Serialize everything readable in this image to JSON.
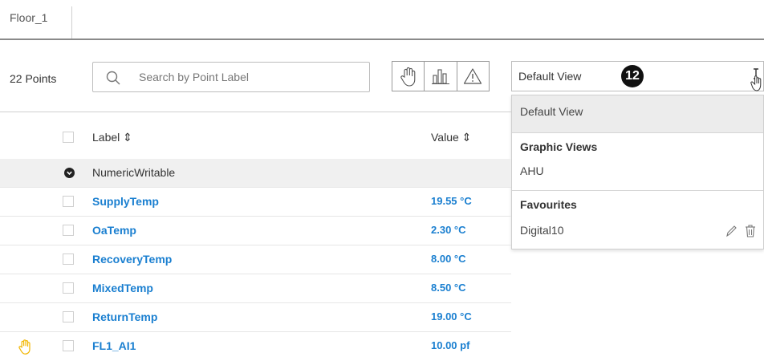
{
  "tabs": [
    {
      "label": "Floor_1"
    }
  ],
  "toolbar": {
    "points_count": "22 Points",
    "search_placeholder": "Search by Point Label",
    "view_selected": "Default View",
    "badge": "12"
  },
  "dropdown": {
    "default_option": "Default View",
    "graphic_views_heading": "Graphic Views",
    "graphic_views": [
      "AHU"
    ],
    "favourites_heading": "Favourites",
    "favourites": [
      "Digital10"
    ]
  },
  "table": {
    "columns": {
      "label": "Label ⇕",
      "value": "Value ⇕"
    },
    "group_name": "NumericWritable",
    "rows": [
      {
        "label": "SupplyTemp",
        "value": "19.55 °C"
      },
      {
        "label": "OaTemp",
        "value": "2.30 °C"
      },
      {
        "label": "RecoveryTemp",
        "value": "8.00 °C"
      },
      {
        "label": "MixedTemp",
        "value": "8.50 °C"
      },
      {
        "label": "ReturnTemp",
        "value": "19.00 °C"
      },
      {
        "label": "FL1_AI1",
        "value": "10.00 pf"
      }
    ]
  },
  "colors": {
    "link": "#1a7fd0",
    "hand_icon": "#f2b705"
  },
  "icons": [
    "search-icon",
    "hand-icon",
    "chart-icon",
    "alarm-icon",
    "edit-icon",
    "trash-icon",
    "cursor-icon",
    "chevron-down-icon"
  ]
}
